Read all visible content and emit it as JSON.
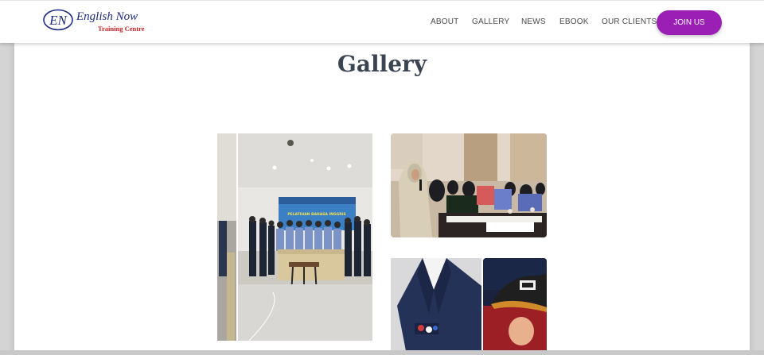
{
  "brand": {
    "logo_initials": "EN",
    "name": "English Now",
    "subtitle": "Training Centre"
  },
  "nav": {
    "items": [
      "ABOUT",
      "GALLERY",
      "NEWS",
      "EBOOK",
      "OUR CLIENTS"
    ],
    "cta": "JOIN US"
  },
  "main": {
    "title": "Gallery",
    "photos": [
      {
        "alt": "Group photo in a meeting hall"
      },
      {
        "alt": "Speaker with microphone at conference tables"
      },
      {
        "alt": "Man in a navy blazer with pocket square"
      },
      {
        "alt": "Person wearing a black cap"
      }
    ],
    "banner_text": "PELATIHAN BAHASA INGGRIS"
  },
  "colors": {
    "accent": "#9b1eb5",
    "title": "#3b4452",
    "brand_blue": "#1d2b86",
    "brand_red": "#d21f1f"
  }
}
